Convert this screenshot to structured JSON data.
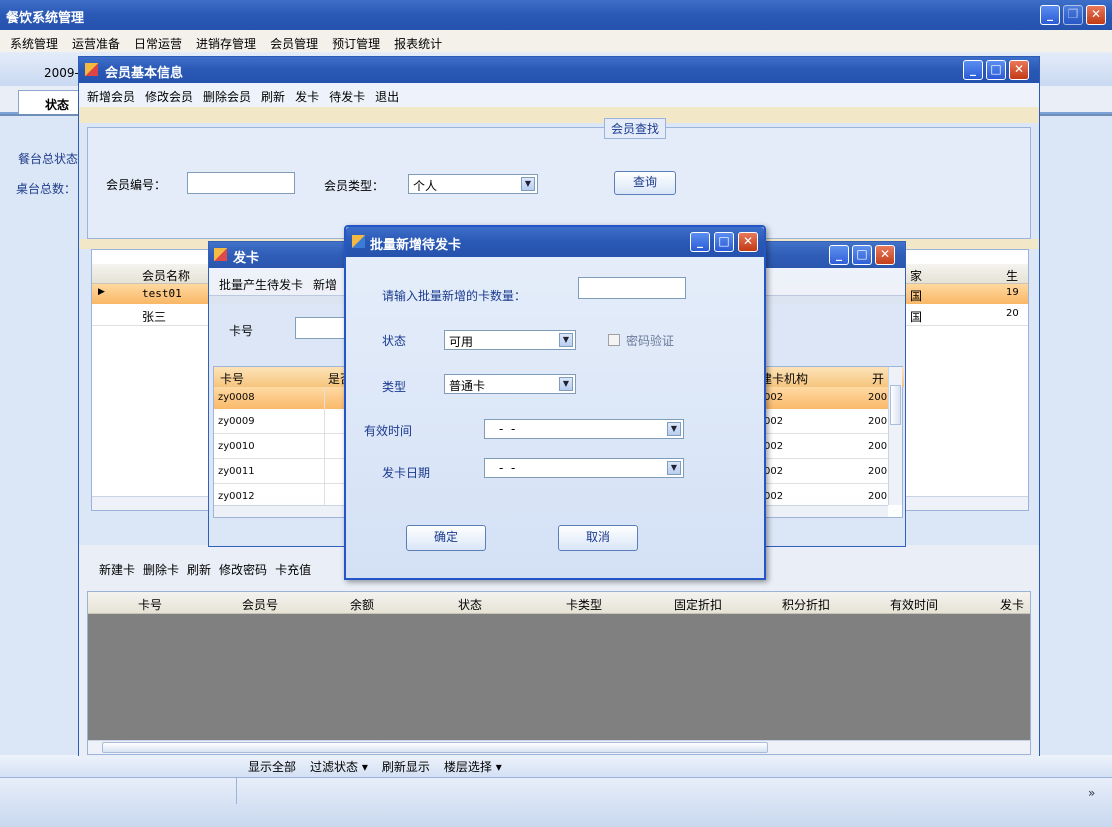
{
  "main": {
    "title": "餐饮系统管理",
    "menu": [
      "系统管理",
      "运营准备",
      "日常运营",
      "进销存管理",
      "会员管理",
      "预订管理",
      "报表统计"
    ],
    "date_partial": "2009-",
    "tab": "状态",
    "side1": "餐台总状态",
    "side2": "桌台总数：",
    "bottom_toolbar": [
      "显示全部",
      "过滤状态 ▾",
      "刷新显示",
      "楼层选择 ▾"
    ],
    "chevron": "»"
  },
  "member": {
    "title": "会员基本信息",
    "toolbar": [
      "新增会员",
      "修改会员",
      "删除会员",
      "刷新",
      "发卡",
      "待发卡",
      "退出"
    ],
    "search_group": "会员查找",
    "id_label": "会员编号：",
    "type_label": "会员类型：",
    "type_value": "个人",
    "query_btn": "查询",
    "grid_headers": [
      "会员名称",
      "家",
      "生"
    ],
    "rows": [
      {
        "name": "test01",
        "c2": "国",
        "c3": "19"
      },
      {
        "name": "张三",
        "c2": "国",
        "c3": "20"
      }
    ],
    "card_toolbar": [
      "新建卡",
      "删除卡",
      "刷新",
      "修改密码",
      "卡充值"
    ],
    "card_headers": [
      "卡号",
      "会员号",
      "余额",
      "状态",
      "卡类型",
      "固定折扣",
      "积分折扣",
      "有效时间",
      "发卡"
    ]
  },
  "issue": {
    "title": "发卡",
    "toolbar": [
      "批量产生待发卡",
      "新增"
    ],
    "card_label": "卡号",
    "headers": [
      "卡号",
      "是否",
      "建卡机构",
      "开"
    ],
    "rows": [
      {
        "no": "zy0008",
        "org": "002",
        "d": "200"
      },
      {
        "no": "zy0009",
        "org": "002",
        "d": "200"
      },
      {
        "no": "zy0010",
        "org": "002",
        "d": "200"
      },
      {
        "no": "zy0011",
        "org": "002",
        "d": "200"
      },
      {
        "no": "zy0012",
        "org": "002",
        "d": "200"
      }
    ]
  },
  "batch": {
    "title": "批量新增待发卡",
    "qty_label": "请输入批量新增的卡数量：",
    "status_label": "状态",
    "status_value": "可用",
    "pwd_label": "密码验证",
    "type_label": "类型",
    "type_value": "普通卡",
    "valid_label": "有效时间",
    "valid_value": "-  -",
    "date_label": "发卡日期",
    "date_value": "-  -",
    "ok": "确定",
    "cancel": "取消"
  }
}
